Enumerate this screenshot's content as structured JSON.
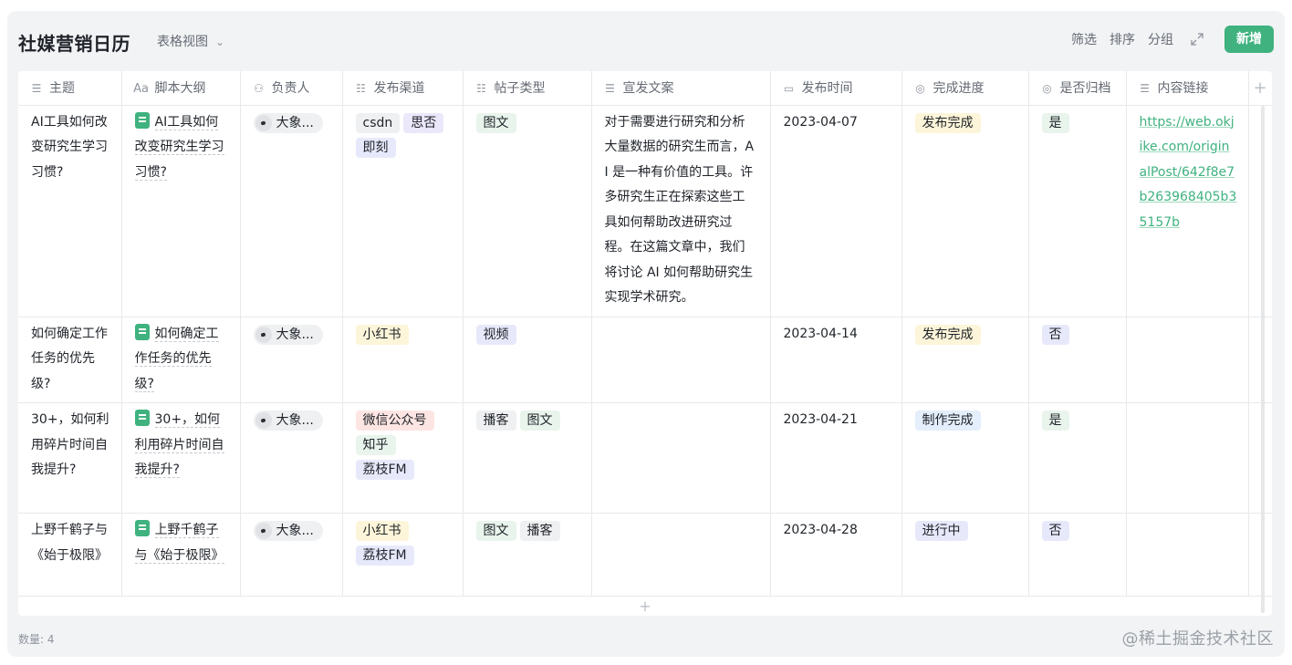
{
  "app": {
    "title": "社媒营销日历",
    "view_label": "表格视图"
  },
  "toolbar": {
    "filter": "筛选",
    "sort": "排序",
    "group": "分组",
    "new": "新增"
  },
  "columns": [
    {
      "label": "主题",
      "icon": "text-lines-icon"
    },
    {
      "label": "脚本大纲",
      "icon": "Aa",
      "icon_name": "text-aa-icon"
    },
    {
      "label": "负责人",
      "icon": "person-icon"
    },
    {
      "label": "发布渠道",
      "icon": "multi-select-icon"
    },
    {
      "label": "帖子类型",
      "icon": "multi-select-icon"
    },
    {
      "label": "宣发文案",
      "icon": "text-lines-icon"
    },
    {
      "label": "发布时间",
      "icon": "calendar-icon"
    },
    {
      "label": "完成进度",
      "icon": "check-circle-icon"
    },
    {
      "label": "是否归档",
      "icon": "check-circle-icon"
    },
    {
      "label": "内容链接",
      "icon": "text-lines-icon"
    }
  ],
  "rows": [
    {
      "topic": "AI工具如何改变研究生学习习惯?",
      "outline": "AI工具如何改变研究生学习习惯?",
      "owner": "大象...",
      "channels": [
        {
          "label": "csdn",
          "color": "gray"
        },
        {
          "label": "思否",
          "color": "purple"
        },
        {
          "label": "即刻",
          "color": "lav"
        }
      ],
      "post_types": [
        {
          "label": "图文",
          "color": "green"
        }
      ],
      "copy": "对于需要进行研究和分析大量数据的研究生而言，AI 是一种有价值的工具。许多研究生正在探索这些工具如何帮助改进研究过程。在这篇文章中，我们将讨论 AI 如何帮助研究生实现学术研究。",
      "date": "2023-04-07",
      "progress": {
        "label": "发布完成",
        "color": "yellow"
      },
      "archived": {
        "label": "是",
        "color": "green"
      },
      "link": "https://web.okjike.com/originalPost/642f8e7b263968405b35157b"
    },
    {
      "topic": "如何确定工作任务的优先级?",
      "outline": "如何确定工作任务的优先级?",
      "owner": "大象...",
      "channels": [
        {
          "label": "小红书",
          "color": "yellow"
        }
      ],
      "post_types": [
        {
          "label": "视频",
          "color": "lav"
        }
      ],
      "copy": "",
      "date": "2023-04-14",
      "progress": {
        "label": "发布完成",
        "color": "yellow"
      },
      "archived": {
        "label": "否",
        "color": "lav"
      },
      "link": ""
    },
    {
      "topic": "30+，如何利用碎片时间自我提升?",
      "outline": "30+，如何利用碎片时间自我提升?",
      "owner": "大象...",
      "channels": [
        {
          "label": "微信公众号",
          "color": "red"
        },
        {
          "label": "知乎",
          "color": "green"
        },
        {
          "label": "荔枝FM",
          "color": "lav"
        }
      ],
      "post_types": [
        {
          "label": "播客",
          "color": "gray"
        },
        {
          "label": "图文",
          "color": "green"
        }
      ],
      "copy": "",
      "date": "2023-04-21",
      "progress": {
        "label": "制作完成",
        "color": "blue"
      },
      "archived": {
        "label": "是",
        "color": "green"
      },
      "link": ""
    },
    {
      "topic": "上野千鹤子与《始于极限》",
      "outline": "上野千鹤子与《始于极限》",
      "owner": "大象...",
      "channels": [
        {
          "label": "小红书",
          "color": "yellow"
        },
        {
          "label": "荔枝FM",
          "color": "lav"
        }
      ],
      "post_types": [
        {
          "label": "图文",
          "color": "green"
        },
        {
          "label": "播客",
          "color": "gray"
        }
      ],
      "copy": "",
      "date": "2023-04-28",
      "progress": {
        "label": "进行中",
        "color": "lav"
      },
      "archived": {
        "label": "否",
        "color": "lav"
      },
      "link": ""
    }
  ],
  "footer": {
    "count": "数量: 4",
    "watermark": "@稀土掘金技术社区"
  },
  "colors": {
    "accent": "#3fb27f",
    "gray": "#eff0f1",
    "green": "#e8f4ec",
    "purple": "#ece8fb",
    "yellow": "#fdf5d9",
    "red": "#fde5e3",
    "blue": "#e4eefc",
    "lav": "#e7e9fb"
  }
}
